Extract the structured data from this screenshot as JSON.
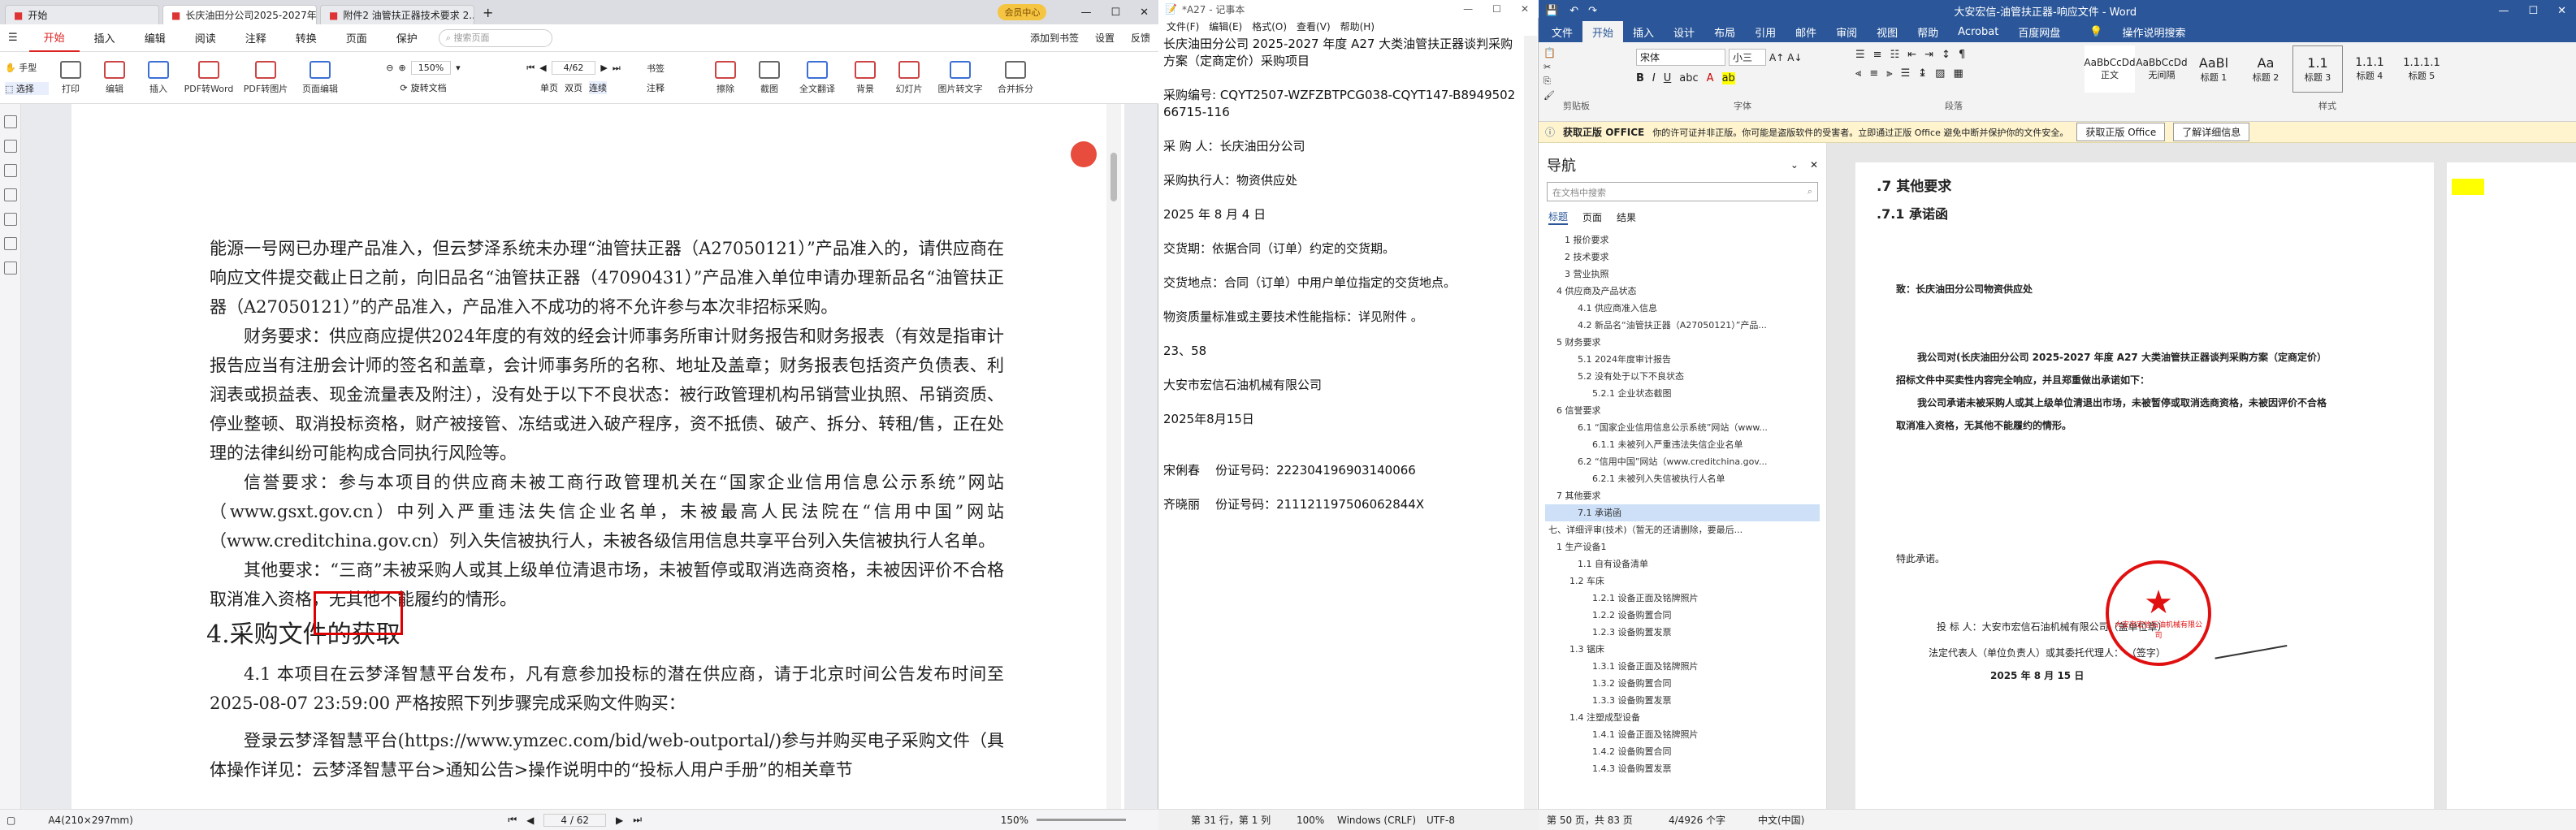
{
  "pdf": {
    "tabs": [
      "开始",
      "长庆油田分公司2025-2027年...",
      "附件2 油管扶正器技术要求 2..."
    ],
    "vip": "会员中心",
    "menu": [
      "开始",
      "插入",
      "编辑",
      "阅读",
      "注释",
      "转换",
      "页面",
      "保护"
    ],
    "search_placeholder": "搜索页面",
    "menu_right": [
      "添加到书签",
      "设置",
      "反馈"
    ],
    "toolbar": [
      "手型",
      "选择",
      "打印",
      "编辑",
      "插入",
      "PDF转Word",
      "PDF转图片",
      "页面编辑",
      "旋转文档",
      "单页",
      "双页",
      "连续",
      "书签",
      "注释",
      "擦除",
      "截图",
      "全文翻译",
      "背景",
      "幻灯片",
      "图片转文字",
      "合并拆分"
    ],
    "zoom": "150%",
    "page_input": "4/62",
    "paragraphs": [
      "能源一号网已办理产品准入，但云梦泽系统未办理“油管扶正器（A27050121）”产品准入的，请供应商在响应文件提交截止日之前，向旧品名“油管扶正器（47090431）”产品准入单位申请办理新品名“油管扶正器（A27050121）”的产品准入，产品准入不成功的将不允许参与本次非招标采购。",
      "财务要求：供应商应提供2024年度的有效的经会计师事务所审计财务报告和财务报表（有效是指审计报告应当有注册会计师的签名和盖章，会计师事务所的名称、地址及盖章；财务报表包括资产负债表、利润表或损益表、现金流量表及附注），没有处于以下不良状态：被行政管理机构吊销营业执照、吊销资质、停业整顿、取消投标资格，财产被接管、冻结或进入破产程序，资不抵债、破产、拆分、转租/售，正在处理的法律纠纷可能构成合同执行风险等。",
      "信誉要求：参与本项目的供应商未被工商行政管理机关在“国家企业信用信息公示系统”网站（www.gsxt.gov.cn）中列入严重违法失信企业名单，未被最高人民法院在“信用中国”网站（www.creditchina.gov.cn）列入失信被执行人，未被各级信用信息共享平台列入失信被执行人名单。",
      "其他要求：“三商”未被采购人或其上级单位清退市场，未被暂停或取消选商资格，未被因评价不合格取消准入资格，无其他不能履约的情形。"
    ],
    "heading": "4.采购文件的获取",
    "para41": "4.1 本项目在云梦泽智慧平台发布，凡有意参加投标的潜在供应商，请于北京时间公告发布时间至 2025-08-07 23:59:00 严格按照下列步骤完成采购文件购买：",
    "para_login": "登录云梦泽智慧平台(https://www.ymzec.com/bid/web-outportal/)参与并购买电子采购文件（具体操作详见：云梦泽智慧平台>通知公告>操作说明中的“投标人用户手册”的相关章节",
    "status_size": "A4(210×297mm)",
    "status_page": "4 / 62",
    "status_zoom": "150%"
  },
  "notepad": {
    "title": "*A27 - 记事本",
    "menu": [
      "文件(F)",
      "编辑(E)",
      "格式(O)",
      "查看(V)",
      "帮助(H)"
    ],
    "lines": [
      "长庆油田分公司 2025-2027 年度 A27 大类油管扶正器谈判采购方案（定商定价）采购项目",
      "",
      "采购编号: CQYT2507-WZFZBTPCG038-CQYT147-B894950266715-116",
      "",
      "采 购 人：长庆油田分公司",
      "",
      "采购执行人：物资供应处",
      "",
      "2025 年 8 月 4 日",
      "",
      "交货期：依据合同（订单）约定的交货期。",
      "",
      "交货地点：合同（订单）中用户单位指定的交货地点。",
      "",
      "物资质量标准或主要技术性能指标：详见附件 。",
      "",
      "23、58",
      "",
      "大安市宏信石油机械有限公司",
      "",
      "2025年8月15日",
      "",
      "",
      "宋俐春    份证号码：222304196903140066",
      "",
      "齐晓丽    份证号码：211121197506062844X"
    ],
    "status": [
      "第 31 行，第 1 列",
      "100%",
      "Windows (CRLF)",
      "UTF-8"
    ]
  },
  "word": {
    "title": "大安宏信-油管扶正器-响应文件 - Word",
    "tabs": [
      "文件",
      "开始",
      "插入",
      "设计",
      "布局",
      "引用",
      "邮件",
      "审阅",
      "视图",
      "帮助",
      "Acrobat",
      "百度网盘",
      "操作说明搜索"
    ],
    "font_name": "宋体",
    "font_size": "小三",
    "styles": [
      "AaBbCcDd",
      "AaBbCcDd",
      "AaBl",
      "Aa",
      "1.1",
      "1.1.1",
      "1.1.1.1"
    ],
    "style_names": [
      "正文",
      "无间隔",
      "标题 1",
      "标题 2",
      "标题 3",
      "标题 4",
      "标题 5"
    ],
    "group_names": [
      "剪贴板",
      "字体",
      "段落",
      "样式"
    ],
    "msg_bold": "获取正版 OFFICE",
    "msg_text": "你的许可证并非正版。你可能是盗版软件的受害者。立即通过正版 Office 避免中断并保护你的文件安全。",
    "msg_btn1": "获取正版 Office",
    "msg_btn2": "了解详细信息",
    "nav_title": "导航",
    "nav_search": "在文档中搜索",
    "nav_tabs": [
      "标题",
      "页面",
      "结果"
    ],
    "nav_items": [
      "1 报价要求",
      "2 技术要求",
      "3 营业执照",
      "4 供应商及产品状态",
      "4.1 供应商准入信息",
      "4.2 新品名“油管扶正器（A27050121）”产品...",
      "5 财务要求",
      "5.1 2024年度审计报告",
      "5.2 没有处于以下不良状态",
      "5.2.1 企业状态截图",
      "6 信誉要求",
      "6.1 “国家企业信用信息公示系统”网站（www...",
      "6.1.1 未被列入严重违法失信企业名单",
      "6.2 “信用中国”网站（www.creditchina.gov...",
      "6.2.1 未被列入失信被执行人名单",
      "7 其他要求",
      "7.1 承诺函",
      "七、详细评审(技术)（暂无的还请删除，要最后...",
      "1 生产设备1",
      "1.1 自有设备清单",
      "1.2 车床",
      "1.2.1 设备正面及铭牌照片",
      "1.2.2 设备购置合同",
      "1.2.3 设备购置发票",
      "1.3 锯床",
      "1.3.1 设备正面及铭牌照片",
      "1.3.2 设备购置合同",
      "1.3.3 设备购置发票",
      "1.4 注塑成型设备",
      "1.4.1 设备正面及铭牌照片",
      "1.4.2 设备购置合同",
      "1.4.3 设备购置发票"
    ],
    "page": {
      "h1": ".7    其他要求",
      "h2": ".7.1    承诺函",
      "to": "致：长庆油田分公司物资供应处",
      "p1": "我公司对(长庆油田分公司 2025-2027 年度 A27 大类油管扶正器谈判采购方案（定商定价）招标文件中买卖性内容完全响应，并且郑重做出承诺如下：",
      "p2": "我公司承诺未被采购人或其上级单位清退出市场，未被暂停或取消选商资格，未被因评价不合格取消准入资格，无其他不能履约的情形。",
      "p3": "特此承诺。",
      "sign1": "投 标 人：大安市宏信石油机械有限公司（盖单位章）",
      "sign2": "法定代表人（单位负责人）或其委托代理人：         （签字）",
      "sign3": "2025 年 8 月 15 日",
      "seal_text": "大安市宏信石油机械有限公司"
    },
    "status_left": "第 50 页，共 83 页",
    "status_words": "4/4926 个字",
    "status_lang": "中文(中国)"
  },
  "colors": {
    "word_blue": "#2b579a",
    "pdf_red": "#d22222",
    "seal_red": "#e01010"
  }
}
